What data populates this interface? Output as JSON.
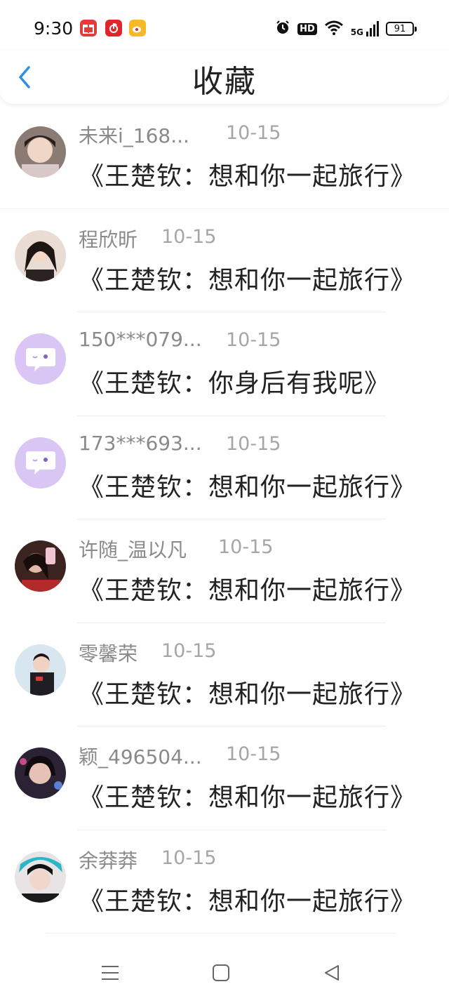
{
  "status_bar": {
    "time": "9:30",
    "network_label": "5G",
    "battery_level": "91",
    "hd_label": "HD",
    "app_icons": [
      "gift-icon",
      "netease-music-icon",
      "weibo-icon"
    ]
  },
  "header": {
    "title": "收藏",
    "back_icon": "chevron-left-icon",
    "accent_color": "#2f8fe6"
  },
  "favorites": [
    {
      "username": "未来i_168...",
      "date": "10-15",
      "title": "《王楚钦：想和你一起旅行》",
      "avatar": "photo"
    },
    {
      "username": "程欣昕",
      "date": "10-15",
      "title": "《王楚钦：想和你一起旅行》",
      "avatar": "photo"
    },
    {
      "username": "150***079...",
      "date": "10-15",
      "title": "《王楚钦：你身后有我呢》",
      "avatar": "default-chat-bubble"
    },
    {
      "username": "173***693...",
      "date": "10-15",
      "title": "《王楚钦：想和你一起旅行》",
      "avatar": "default-chat-bubble"
    },
    {
      "username": "许随_温以凡",
      "date": "10-15",
      "title": "《王楚钦：想和你一起旅行》",
      "avatar": "photo"
    },
    {
      "username": "零馨荣",
      "date": "10-15",
      "title": "《王楚钦：想和你一起旅行》",
      "avatar": "photo"
    },
    {
      "username": "颖_496504...",
      "date": "10-15",
      "title": "《王楚钦：想和你一起旅行》",
      "avatar": "photo"
    },
    {
      "username": "余莽莽",
      "date": "10-15",
      "title": "《王楚钦：想和你一起旅行》",
      "avatar": "photo"
    }
  ],
  "nav_bar": {
    "buttons": [
      "menu-icon",
      "home-square-icon",
      "back-triangle-icon"
    ]
  }
}
